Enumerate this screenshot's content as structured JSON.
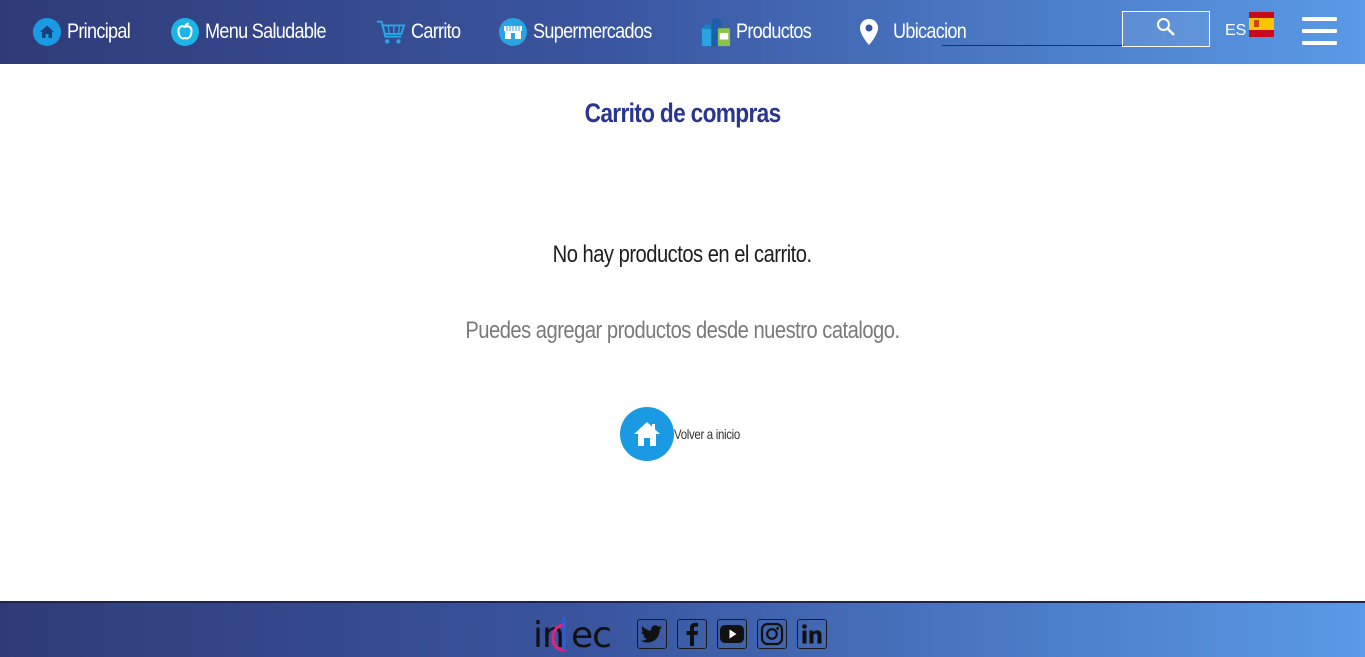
{
  "nav": {
    "items": [
      {
        "label": "Principal",
        "icon": "home-icon"
      },
      {
        "label": "Menu Saludable",
        "icon": "apple-icon"
      },
      {
        "label": "Carrito",
        "icon": "cart-icon"
      },
      {
        "label": "Supermercados",
        "icon": "store-icon"
      },
      {
        "label": "Productos",
        "icon": "products-icon"
      },
      {
        "label": "Ubicacion",
        "icon": "location-pin-icon"
      }
    ],
    "search": {
      "placeholder": "",
      "value": ""
    },
    "language": {
      "code": "ES",
      "flag": "spain-flag-icon"
    }
  },
  "main": {
    "title": "Carrito de compras",
    "empty_message": "No hay productos en el carrito.",
    "hint": "Puedes agregar productos desde nuestro catalogo.",
    "back_label": "Volver a inicio"
  },
  "footer": {
    "logo": "indec",
    "social": [
      "twitter-icon",
      "facebook-icon",
      "youtube-icon",
      "instagram-icon",
      "linkedin-icon"
    ]
  },
  "colors": {
    "nav_gradient_start": "#2f3b78",
    "nav_gradient_end": "#5a9ae6",
    "title": "#2a3590",
    "accent": "#1b9ae4"
  }
}
